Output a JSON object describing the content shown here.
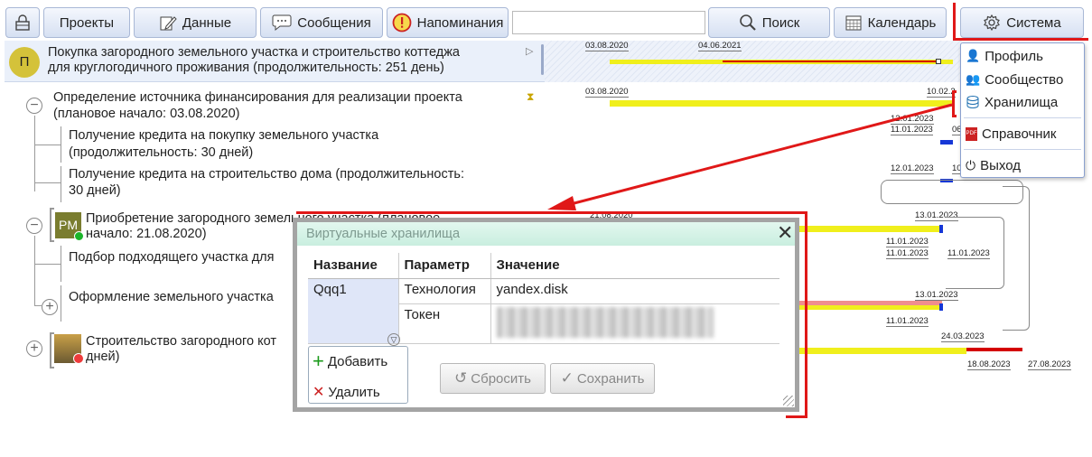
{
  "toolbar": {
    "lock_icon": "lock-icon",
    "projects": "Проекты",
    "data": "Данные",
    "messages": "Сообщения",
    "reminders": "Напоминания",
    "search_value": "",
    "search": "Поиск",
    "calendar": "Календарь",
    "system": "Система"
  },
  "project": {
    "badge": "П",
    "line1": "Покупка загородного земельного участка и строительство коттеджа",
    "line2": "для круглогодичного проживания (продолжительность: 251 день)"
  },
  "tasks": {
    "t1_line1": "Определение источника финансирования для реализации проекта",
    "t1_line2": "(плановое начало: 03.08.2020)",
    "t1a_line1": "Получение кредита на покупку земельного участка",
    "t1a_line2": "(продолжительность: 30 дней)",
    "t1b_line1": "Получение кредита на строительство дома (продолжительность:",
    "t1b_line2": "30 дней)",
    "t2_avatar": "PM",
    "t2_line1": "Приобретение загородного земельного участка (плановое",
    "t2_line2": "начало: 21.08.2020)",
    "t2a": "Подбор подходящего участка для",
    "t2b": "Оформление земельного участка",
    "t3_line1": "Строительство загородного кот",
    "t3_line2": "дней)"
  },
  "gantt": {
    "d1": "03.08.2020",
    "d2": "04.06.2021",
    "d3": "03.08.2020",
    "d4": "10.02.2",
    "d5": "12.01.2023",
    "d6": "11.01.2023",
    "d7": "06",
    "d8": "12.01.2023",
    "d9": "10",
    "d10": "21.08.2020",
    "d11": "13.01.2023",
    "d12": "11.01.2023",
    "d13": "11.01.2023",
    "d14": "11.01.2023",
    "d15": "13.01.2023",
    "d16": "11.01.2023",
    "d17": "24.03.2023",
    "d18": "18.08.2023",
    "d19": "27.08.2023",
    "colors": {
      "yellow": "#f0ef1c",
      "red": "#d40000",
      "blue": "#1637d6",
      "pink": "#f08e8e"
    }
  },
  "menu": {
    "profile": "Профиль",
    "community": "Сообщество",
    "storage": "Хранилища",
    "reference": "Справочник",
    "exit": "Выход"
  },
  "dialog": {
    "title": "Виртуальные хранилища",
    "col_name": "Название",
    "col_param": "Параметр",
    "col_value": "Значение",
    "row_name": "Qqq1",
    "p1": "Технология",
    "v1": "yandex.disk",
    "p2": "Токен",
    "add": "Добавить",
    "delete": "Удалить",
    "reset": "Сбросить",
    "save": "Сохранить"
  },
  "accent": "#e01818"
}
